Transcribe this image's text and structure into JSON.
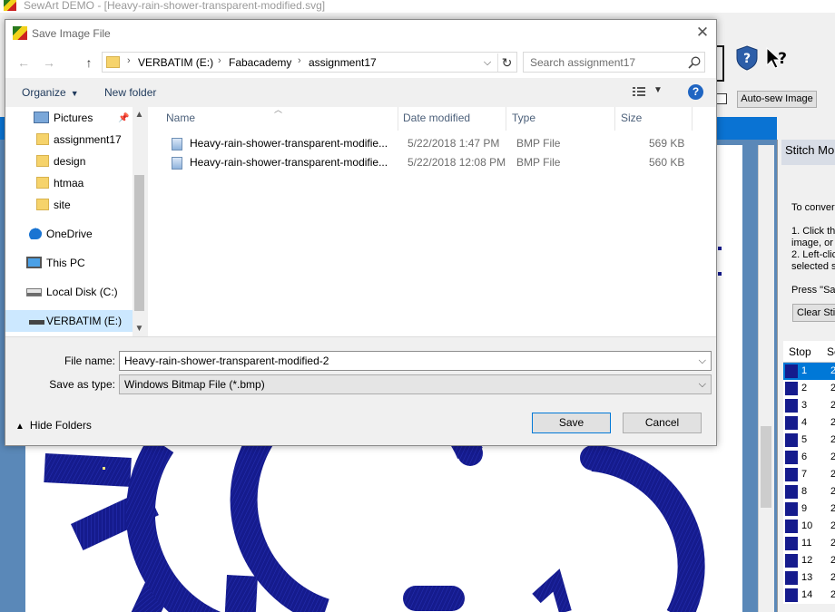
{
  "app": {
    "title": "SewArt DEMO - [Heavy-rain-shower-transparent-modified.svg]",
    "autosew_label": "Auto-sew Image",
    "right_panel": {
      "title": "Stitch Mo",
      "lines": [
        "To conver",
        "1. Click the",
        "image, or",
        "2. Left-clic",
        "selected s",
        "Press \"Sa"
      ],
      "clear_label": "Clear Stit",
      "table_headers": [
        "Stop",
        "Se"
      ],
      "rows": [
        {
          "stop": "1",
          "seq": "2"
        },
        {
          "stop": "2",
          "seq": "2"
        },
        {
          "stop": "3",
          "seq": "2"
        },
        {
          "stop": "4",
          "seq": "2"
        },
        {
          "stop": "5",
          "seq": "2"
        },
        {
          "stop": "6",
          "seq": "2"
        },
        {
          "stop": "7",
          "seq": "2"
        },
        {
          "stop": "8",
          "seq": "2"
        },
        {
          "stop": "9",
          "seq": "2"
        },
        {
          "stop": "10",
          "seq": "2"
        },
        {
          "stop": "11",
          "seq": "2"
        },
        {
          "stop": "12",
          "seq": "2"
        },
        {
          "stop": "13",
          "seq": "2"
        },
        {
          "stop": "14",
          "seq": "2"
        }
      ]
    },
    "stitch_color": "#151b8d"
  },
  "dialog": {
    "title": "Save Image File",
    "close_symbol": "✕",
    "nav": {
      "back": "←",
      "forward": "→",
      "up": "↑",
      "refresh": "↻",
      "dropdown": "⌵"
    },
    "breadcrumb": [
      "VERBATIM (E:)",
      "Fabacademy",
      "assignment17"
    ],
    "breadcrumb_sep": "›",
    "search_placeholder": "Search assignment17",
    "organize_label": "Organize",
    "new_folder_label": "New folder",
    "help_symbol": "?",
    "nav_pane": [
      {
        "label": "Pictures",
        "icon": "pictures-icon"
      },
      {
        "label": "assignment17",
        "icon": "folder-icon"
      },
      {
        "label": "design",
        "icon": "folder-icon"
      },
      {
        "label": "htmaa",
        "icon": "folder-icon"
      },
      {
        "label": "site",
        "icon": "folder-icon"
      },
      {
        "label": "OneDrive",
        "icon": "onedrive-icon"
      },
      {
        "label": "This PC",
        "icon": "pc-icon"
      },
      {
        "label": "Local Disk (C:)",
        "icon": "disk-icon"
      },
      {
        "label": "VERBATIM (E:)",
        "icon": "usb-drive-icon",
        "selected": true
      }
    ],
    "columns": [
      "Name",
      "Date modified",
      "Type",
      "Size"
    ],
    "files": [
      {
        "name": "Heavy-rain-shower-transparent-modifie...",
        "date": "5/22/2018 1:47 PM",
        "type": "BMP File",
        "size": "569 KB"
      },
      {
        "name": "Heavy-rain-shower-transparent-modifie...",
        "date": "5/22/2018 12:08 PM",
        "type": "BMP File",
        "size": "560 KB"
      }
    ],
    "file_name_label": "File name:",
    "file_name_value": "Heavy-rain-shower-transparent-modified-2",
    "save_type_label": "Save as type:",
    "save_type_value": "Windows Bitmap File (*.bmp)",
    "hide_folders_label": "Hide Folders",
    "save_label": "Save",
    "cancel_label": "Cancel"
  }
}
